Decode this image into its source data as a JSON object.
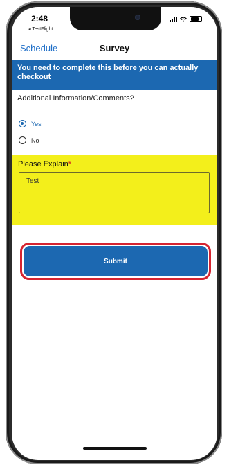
{
  "status_bar": {
    "time": "2:48",
    "back_app": "◂ TestFlight"
  },
  "nav": {
    "back_label": "Schedule",
    "title": "Survey"
  },
  "banner": {
    "text": "You need to complete this before you can actually checkout"
  },
  "question": {
    "label": "Additional Information/Comments?",
    "options": [
      {
        "label": "Yes",
        "selected": true
      },
      {
        "label": "No",
        "selected": false
      }
    ]
  },
  "explain": {
    "label": "Please Explain",
    "required_mark": "*",
    "value": "Test"
  },
  "submit": {
    "label": "Submit"
  },
  "colors": {
    "primary": "#1c68b1",
    "highlight": "#f3ef1b",
    "outline_red": "#d62430",
    "link": "#1f6fc8"
  }
}
